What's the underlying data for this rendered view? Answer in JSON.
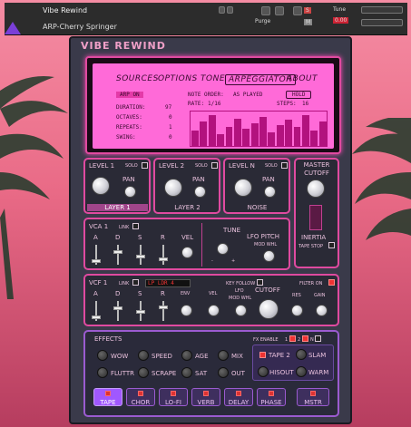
{
  "header": {
    "instrument_name": "Vibe Rewind",
    "preset_name": "ARP-Cherry Springer",
    "purge_label": "Purge",
    "tune_label": "Tune",
    "tune_value": "0.00",
    "s_label": "S",
    "m_label": "M"
  },
  "instrument": {
    "title": "VIBE REWIND"
  },
  "screen": {
    "tabs": [
      "SOURCES",
      "OPTIONS",
      "TONE",
      "ARPEGGIATOR",
      "ABOUT"
    ],
    "active_tab": "ARPEGGIATOR",
    "arp_on": "ARP ON",
    "note_order_label": "NOTE ORDER:",
    "note_order_value": "AS PLAYED",
    "hold": "HOLD",
    "duration_label": "DURATION:",
    "duration_value": "97",
    "octaves_label": "OCTAVES:",
    "octaves_value": "0",
    "repeats_label": "REPEATS:",
    "repeats_value": "1",
    "swing_label": "SWING:",
    "swing_value": "0",
    "rate_label": "RATE:",
    "rate_value": "1/16",
    "steps_label": "STEPS:",
    "steps_value": "16",
    "step_levels": [
      0.45,
      0.7,
      0.9,
      0.35,
      0.55,
      0.8,
      0.5,
      0.65,
      0.85,
      0.4,
      0.6,
      0.75,
      0.55,
      0.9,
      0.45,
      0.7
    ]
  },
  "layers": [
    {
      "level": "LEVEL 1",
      "solo": "SOLO",
      "pan": "PAN",
      "name": "LAYER 1"
    },
    {
      "level": "LEVEL 2",
      "solo": "SOLO",
      "pan": "PAN",
      "name": "LAYER 2"
    },
    {
      "level": "LEVEL N",
      "solo": "SOLO",
      "pan": "PAN",
      "name": "NOISE"
    }
  ],
  "master": {
    "cutoff_label": "MASTER CUTOFF",
    "inertia": "INERTIA",
    "tape_stop": "TAPE STOP"
  },
  "vca": {
    "title": "VCA 1",
    "link": "LINK",
    "a": "A",
    "d": "D",
    "s": "S",
    "r": "R",
    "vel": "VEL",
    "tune": "TUNE",
    "lfo_pitch": "LFO PITCH",
    "mod_whl": "MOD WHL",
    "minus": "-",
    "plus": "+"
  },
  "vcf": {
    "title": "VCF 1",
    "link": "LINK",
    "filter_type": "LP LDR 4",
    "key_follow": "KEY FOLLOW",
    "filter_on": "FILTER ON",
    "a": "A",
    "d": "D",
    "s": "S",
    "r": "R",
    "env": "ENV",
    "vel": "VEL",
    "lfo": "LFO",
    "mod_whl": "MOD WHL",
    "cutoff": "CUTOFF",
    "res": "RES",
    "gain": "GAIN"
  },
  "effects": {
    "title": "EFFECTS",
    "fx_enable": "FX ENABLE",
    "fx_one": "1",
    "fx_two": "2",
    "fx_n": "N",
    "knobs_row1": [
      "WOW",
      "SPEED",
      "AGE",
      "MIX"
    ],
    "knobs_row2": [
      "FLUTTR",
      "SCRAPE",
      "SAT",
      "OUT"
    ],
    "tape_stop_label": "TAPE 2",
    "slam": "SLAM",
    "hisout": "HISOUT",
    "warm": "WARM",
    "buttons": [
      "TAPE",
      "CHOR",
      "LO-FI",
      "VERB",
      "DELAY",
      "PHASE",
      "MSTR"
    ],
    "selected": "TAPE"
  },
  "colors": {
    "accent": "#e04aa0",
    "lcd": "#ff6ad8",
    "purple": "#a058ff"
  }
}
